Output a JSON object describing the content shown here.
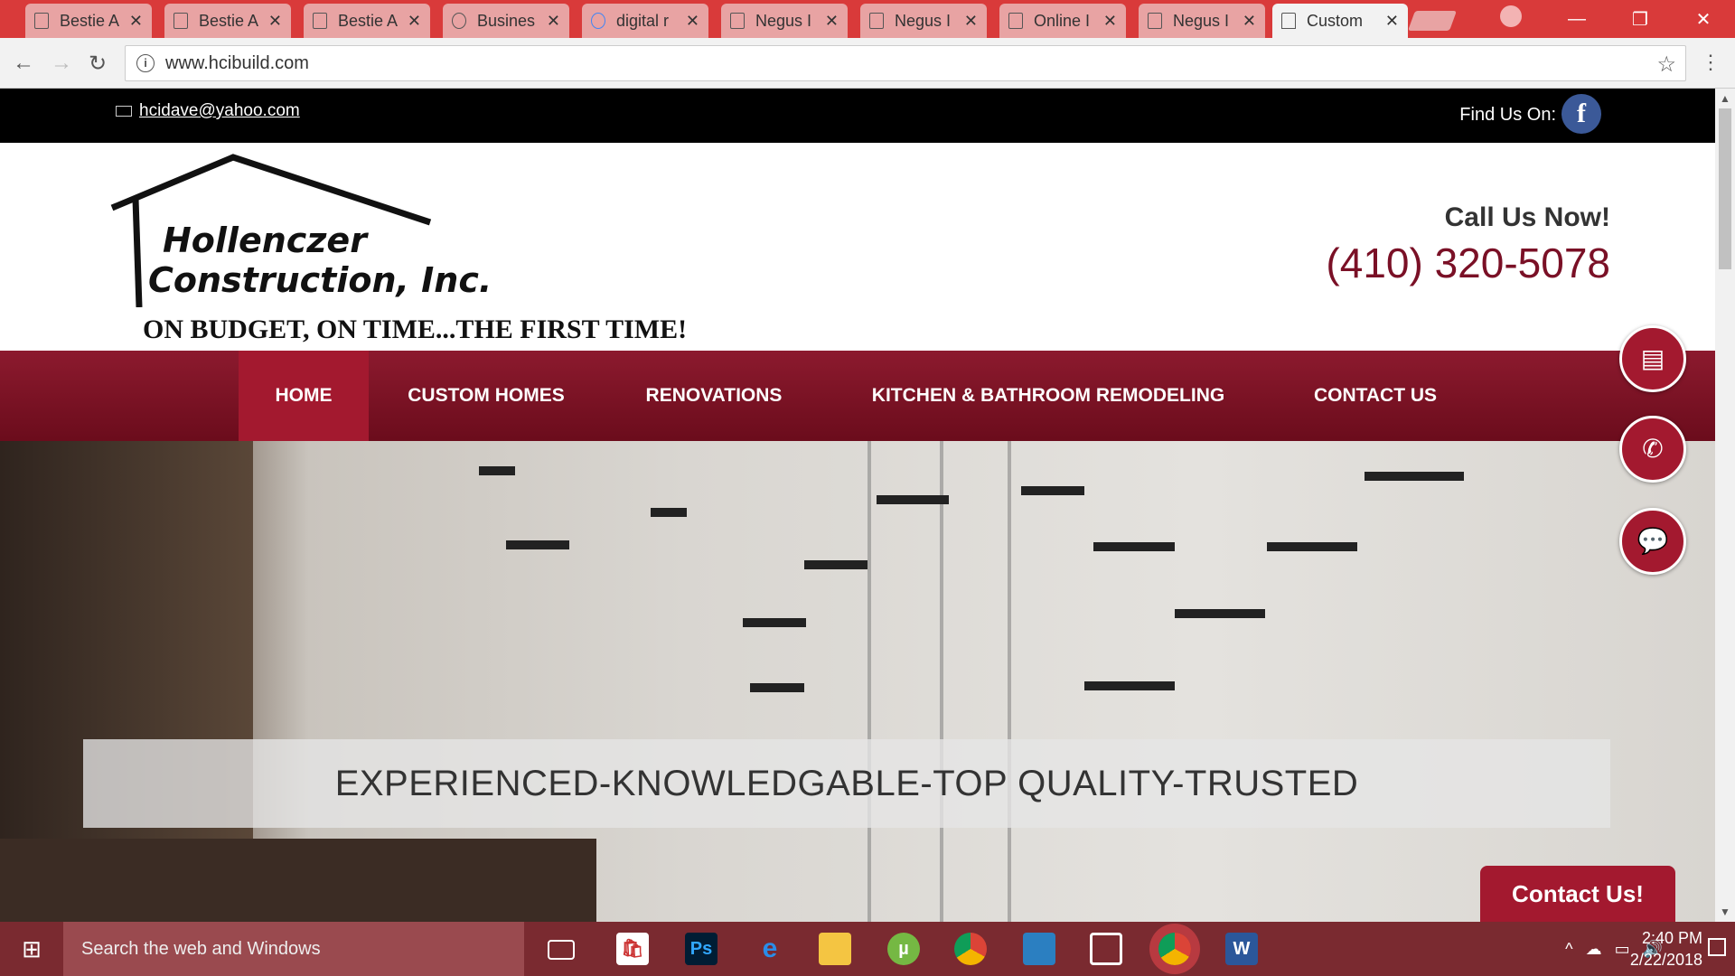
{
  "browser": {
    "tabs": [
      {
        "title": "Bestie A",
        "active": false
      },
      {
        "title": "Bestie A",
        "active": false
      },
      {
        "title": "Bestie A",
        "active": false
      },
      {
        "title": "Busines",
        "active": false
      },
      {
        "title": "digital r",
        "active": false
      },
      {
        "title": "Negus I",
        "active": false
      },
      {
        "title": "Negus I",
        "active": false
      },
      {
        "title": "Online I",
        "active": false
      },
      {
        "title": "Negus I",
        "active": false
      },
      {
        "title": "Custom",
        "active": true
      }
    ],
    "url": "www.hcibuild.com"
  },
  "site": {
    "topbar": {
      "email": "hcidave@yahoo.com",
      "find_us": "Find Us On:",
      "facebook_glyph": "f"
    },
    "logo": {
      "line1": "Hollenczer",
      "line2": "Construction, Inc."
    },
    "tagline": "ON BUDGET, ON TIME...THE FIRST TIME!",
    "call_label": "Call Us Now!",
    "phone": "(410) 320-5078",
    "nav": [
      {
        "label": "HOME",
        "active": true
      },
      {
        "label": "CUSTOM HOMES",
        "active": false
      },
      {
        "label": "RENOVATIONS",
        "active": false
      },
      {
        "label": "KITCHEN & BATHROOM REMODELING",
        "active": false
      },
      {
        "label": "CONTACT US",
        "active": false
      }
    ],
    "hero_text": "EXPERIENCED-KNOWLEDGABLE-TOP QUALITY-TRUSTED",
    "floating_buttons": [
      "document-icon",
      "phone-icon",
      "chat-icon"
    ],
    "contact_tab": "Contact Us!"
  },
  "taskbar": {
    "search_placeholder": "Search the web and Windows",
    "time": "2:40 PM",
    "date": "2/22/2018",
    "apps": [
      "task-view-icon",
      "store-icon",
      "photoshop-icon",
      "edge-icon",
      "file-explorer-icon",
      "utorrent-icon",
      "chrome-icon",
      "mail-icon",
      "app-icon",
      "chrome-active-icon",
      "word-icon"
    ],
    "app_glyphs": {
      "photoshop": "Ps",
      "word": "W"
    }
  },
  "colors": {
    "brand": "#a3192f",
    "nav_bg": "#7a0f22",
    "tabstrip": "#d93a3a",
    "taskbar": "#7a2a30"
  }
}
